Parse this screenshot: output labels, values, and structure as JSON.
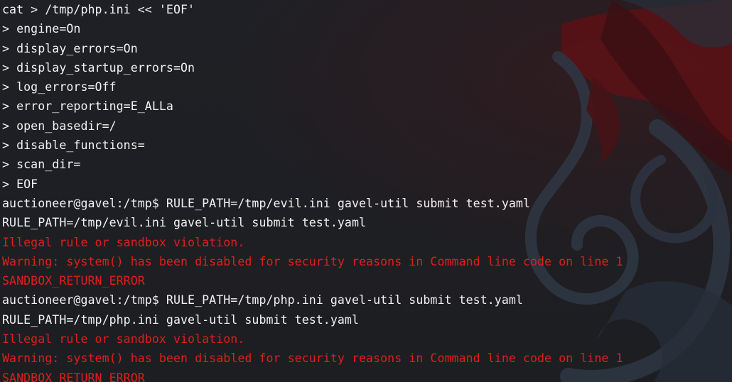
{
  "terminal": {
    "lines": [
      {
        "text": "cat > /tmp/php.ini << 'EOF'",
        "type": "normal"
      },
      {
        "text": "> engine=On",
        "type": "normal"
      },
      {
        "text": "> display_errors=On",
        "type": "normal"
      },
      {
        "text": "> display_startup_errors=On",
        "type": "normal"
      },
      {
        "text": "> log_errors=Off",
        "type": "normal"
      },
      {
        "text": "> error_reporting=E_ALLa",
        "type": "normal"
      },
      {
        "text": "> open_basedir=/",
        "type": "normal"
      },
      {
        "text": "> disable_functions=",
        "type": "normal"
      },
      {
        "text": "> scan_dir=",
        "type": "normal"
      },
      {
        "text": "> EOF",
        "type": "normal"
      },
      {
        "text": "auctioneer@gavel:/tmp$ RULE_PATH=/tmp/evil.ini gavel-util submit test.yaml",
        "type": "normal"
      },
      {
        "text": "RULE_PATH=/tmp/evil.ini gavel-util submit test.yaml",
        "type": "normal"
      },
      {
        "text": "Illegal rule or sandbox violation.",
        "type": "error"
      },
      {
        "text": "Warning: system() has been disabled for security reasons in Command line code on line 1",
        "type": "error"
      },
      {
        "text": "SANDBOX_RETURN_ERROR",
        "type": "error"
      },
      {
        "text": "auctioneer@gavel:/tmp$ RULE_PATH=/tmp/php.ini gavel-util submit test.yaml",
        "type": "normal"
      },
      {
        "text": "RULE_PATH=/tmp/php.ini gavel-util submit test.yaml",
        "type": "normal"
      },
      {
        "text": "Illegal rule or sandbox violation.",
        "type": "error"
      },
      {
        "text": "Warning: system() has been disabled for security reasons in Command line code on line 1",
        "type": "error"
      },
      {
        "text": "SANDBOX_RETURN_ERROR",
        "type": "error"
      }
    ]
  },
  "colors": {
    "background": "#202126",
    "text": "#f2f2f2",
    "error": "#e21d1d",
    "wallpaper_red": "#6f1418",
    "wallpaper_blue": "#2c3440"
  }
}
